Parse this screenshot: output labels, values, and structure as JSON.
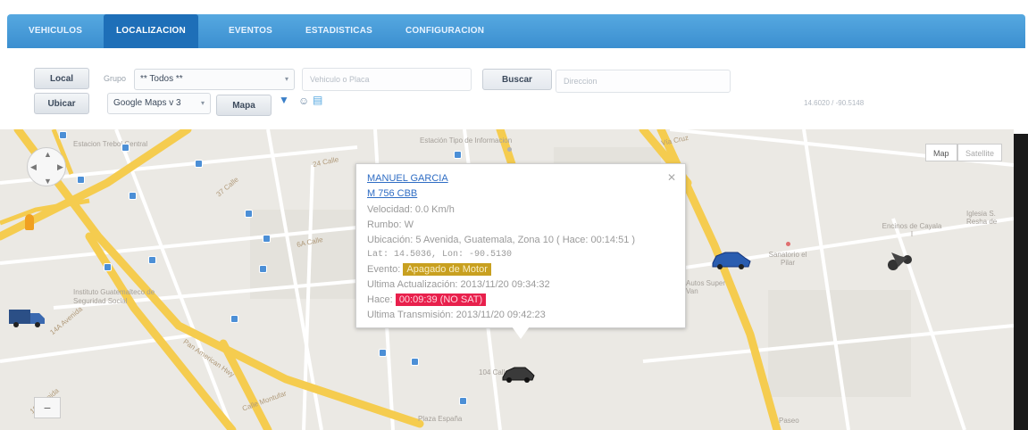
{
  "nav": {
    "tabs": [
      {
        "label": "VEHICULOS"
      },
      {
        "label": "LOCALIZACION"
      },
      {
        "label": "EVENTOS"
      },
      {
        "label": "ESTADISTICAS"
      },
      {
        "label": "CONFIGURACION"
      }
    ],
    "active_tab": "LOCALIZACION"
  },
  "toolbar": {
    "local_label": "Local",
    "ubicar_label": "Ubicar",
    "grupo_label": "Grupo",
    "grupo_value": "** Todos **",
    "search_placeholder": "Vehiculo o Placa",
    "buscar_label": "Buscar",
    "direccion_placeholder": "Direccion",
    "map_provider_value": "Google Maps v 3",
    "mapa_label": "Mapa",
    "coordinates": "14.6020 / -90.5148"
  },
  "map": {
    "type_map": "Map",
    "type_satellite": "Satellite",
    "labels": {
      "estacion_tipo": "Estación Tipo de Informacion",
      "estacion_trebol": "Estacion Trebol Central",
      "calle_24": "24 Calle",
      "calle_37": "37 Calle",
      "via_cruz": "Vía Cruz",
      "calle_6a": "6A Calle",
      "instituto": "Instituto Guatemalteco de Seguridad Social",
      "avenida_14a": "14A Avenida",
      "avenida_18": "18 Avenida",
      "pan_american": "Pan American Hwy",
      "calle_montufar": "Calle Montufar",
      "plaza_espana": "Plaza España",
      "encinos": "Encinos de Cayala I",
      "iglesia": "Iglesia S. Resha de",
      "sanatorio": "Sanatorio el Pilar",
      "autos": "Autos Super Van",
      "paseo": "Paseo",
      "calle_104": "104 Calle"
    }
  },
  "popup": {
    "driver": "MANUEL GARCIA",
    "plate": "M 756 CBB",
    "velocidad": "Velocidad: 0.0 Km/h",
    "rumbo": "Rumbo: W",
    "ubicacion": "Ubicación: 5 Avenida, Guatemala, Zona 10 ( Hace: 00:14:51 )",
    "latlon": "Lat: 14.5036, Lon: -90.5130",
    "evento_label": "Evento:",
    "evento_value": "Apagado de Motor",
    "ultima_actualizacion": "Ultima Actualización: 2013/11/20 09:34:32",
    "hace_label": "Hace:",
    "hace_value": "00:09:39 (NO SAT)",
    "ultima_transmision": "Ultima Transmisión: 2013/11/20 09:42:23"
  },
  "colors": {
    "nav_bg": "#3b8fd0",
    "nav_active": "#1e6fb8",
    "road_major": "#f5cc4f",
    "event_badge": "#c8a020",
    "hace_badge": "#e8204c",
    "vehicle_blue": "#2a5db0"
  }
}
